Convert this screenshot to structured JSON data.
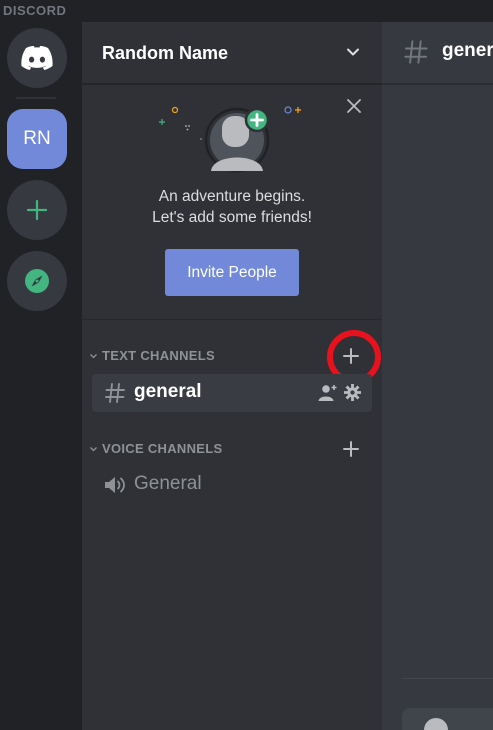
{
  "app": {
    "brand": "DISCORD"
  },
  "guilds": {
    "home_icon": "discord-logo-icon",
    "server_initials": "RN",
    "add_icon": "plus-icon",
    "explore_icon": "compass-icon"
  },
  "server": {
    "name": "Random Name"
  },
  "welcome": {
    "line1": "An adventure begins.",
    "line2": "Let's add some friends!",
    "invite_label": "Invite People"
  },
  "categories": {
    "text": {
      "label": "TEXT CHANNELS"
    },
    "voice": {
      "label": "VOICE CHANNELS"
    }
  },
  "channels": {
    "text": [
      {
        "name": "general"
      }
    ],
    "voice": [
      {
        "name": "General"
      }
    ]
  },
  "main": {
    "channel_name": "general"
  },
  "colors": {
    "accent": "#7289da",
    "green": "#43b581",
    "highlight": "#e8111e",
    "sidebar_bg": "#2f3136",
    "guild_bg": "#202225",
    "chat_bg": "#36393f"
  }
}
